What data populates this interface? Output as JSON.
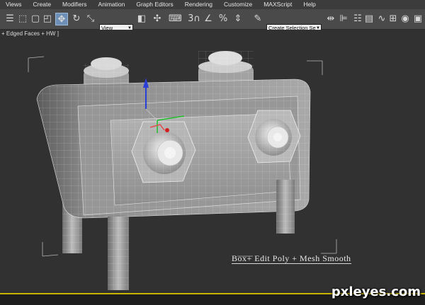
{
  "menu": [
    "Views",
    "Create",
    "Modifiers",
    "Animation",
    "Graph Editors",
    "Rendering",
    "Customize",
    "MAXScript",
    "Help"
  ],
  "toolbar": {
    "reference_coord": "View",
    "selection_set_placeholder": "Create Selection Se",
    "icons": [
      "select-filter-icon",
      "select-object-icon",
      "select-region-icon",
      "window-crossing-icon",
      "select-move-icon",
      "select-rotate-icon",
      "select-scale-icon",
      "use-pivot-icon",
      "select-manipulate-icon",
      "keyboard-shortcut-icon",
      "snap-3d-icon",
      "angle-snap-icon",
      "percent-snap-icon",
      "spinner-snap-icon",
      "edit-named-selection-icon",
      "mirror-icon",
      "align-icon",
      "layer-manager-icon",
      "graphite-ribbon-icon",
      "curve-editor-icon",
      "schematic-view-icon",
      "material-editor-icon",
      "render-setup-icon",
      "rendered-frame-icon",
      "render-icon"
    ]
  },
  "viewport": {
    "label": "+ Edged Faces + HW ]",
    "caption": "Box+ Edit Poly + Mesh Smooth"
  },
  "watermark": "pxleyes.com",
  "colors": {
    "menubar": "#3c3c3c",
    "toolbar": "#4a4a4a",
    "viewport_bg": "#313131",
    "active_viewport_border": "#c9b400",
    "gizmo_x": "#d22020",
    "gizmo_y": "#1fbf2a",
    "gizmo_z": "#2a3fd6"
  }
}
